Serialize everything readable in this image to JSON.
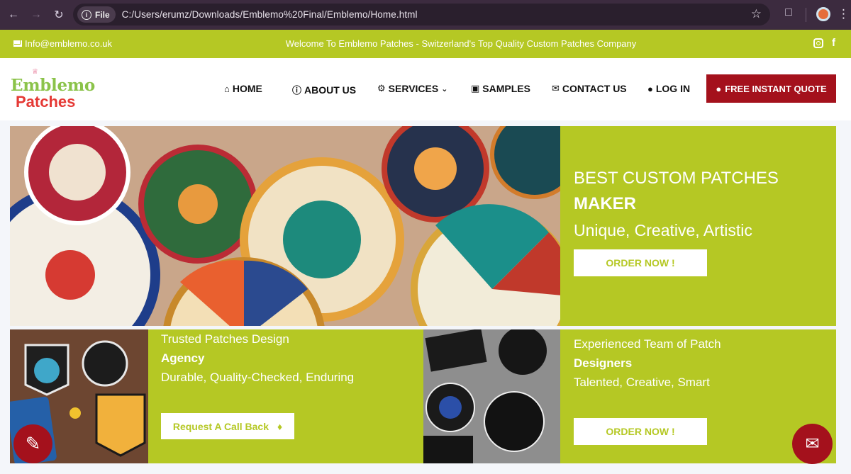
{
  "browser": {
    "file_label": "File",
    "url": "C:/Users/erumz/Downloads/Emblemo%20Final/Emblemo/Home.html"
  },
  "topbar": {
    "email": "Info@emblemo.co.uk",
    "welcome": "Welcome To Emblemo Patches - Switzerland's Top Quality Custom Patches Company"
  },
  "logo": {
    "line1": "Emblemo",
    "line2": "Patches"
  },
  "nav": {
    "home": "HOME",
    "about": "ABOUT US",
    "services": "SERVICES",
    "samples": "SAMPLES",
    "contact": "CONTACT US",
    "login": "LOG IN",
    "quote": "FREE INSTANT QUOTE"
  },
  "hero": {
    "line1": "BEST CUSTOM PATCHES",
    "line2": "MAKER",
    "line3": "Unique, Creative, Artistic",
    "button": "ORDER NOW !"
  },
  "card1": {
    "line1": "Trusted Patches Design",
    "line2": "Agency",
    "line3": "Durable, Quality-Checked, Enduring",
    "button": "Request A Call Back"
  },
  "card2": {
    "line1": "Experienced Team of Patch",
    "line2": "Designers",
    "line3": "Talented, Creative, Smart",
    "button": "ORDER NOW !"
  },
  "colors": {
    "accent": "#b5c824",
    "brand_red": "#a4111c",
    "browser_bg": "#3c2b3f"
  },
  "icons": {
    "email": "envelope-icon",
    "instagram": "instagram-icon",
    "facebook": "facebook-icon",
    "home": "home-icon",
    "about": "info-icon",
    "services": "gear-icon",
    "samples": "images-icon",
    "contact": "envelope-icon",
    "login": "user-icon",
    "quote": "whatsapp-icon",
    "call": "bell-icon",
    "float_left": "pencil-ruler-icon",
    "float_right": "chat-icon"
  }
}
